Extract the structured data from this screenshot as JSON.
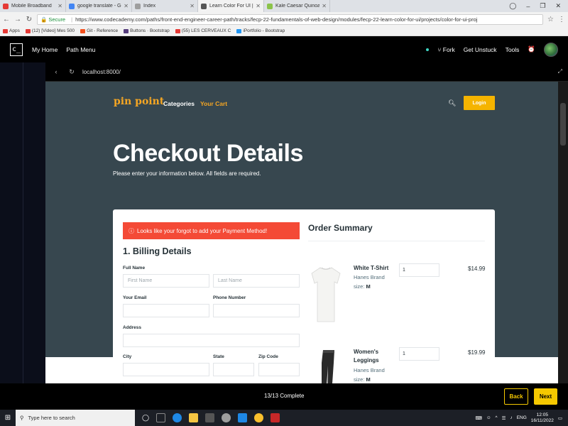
{
  "browser": {
    "tabs": [
      {
        "label": "Mobile Broadband",
        "color": "#e53935",
        "active": false
      },
      {
        "label": "google translate - Goog",
        "color": "#4285f4",
        "active": false
      },
      {
        "label": "Index",
        "color": "#9e9e9e",
        "active": false
      },
      {
        "label": "Learn Color For UI | Cod",
        "color": "#555555",
        "active": true
      },
      {
        "label": "Kale Caesar Quinoa Sala",
        "color": "#8bc34a",
        "active": false
      }
    ],
    "address": {
      "secure_label": "Secure",
      "url": "https://www.codecademy.com/paths/front-end-engineer-career-path/tracks/fecp-22-fundamentals-of-web-design/modules/fecp-22-learn-color-for-ui/projects/color-for-ui-proj"
    },
    "bookmarks": [
      {
        "label": "Apps",
        "color": "#e53935"
      },
      {
        "label": "(12) [Video] Mes 500",
        "color": "#e53935"
      },
      {
        "label": "Git - Reference",
        "color": "#f4511e"
      },
      {
        "label": "Buttons · Bootstrap",
        "color": "#563d7c"
      },
      {
        "label": "(55) LES CERVEAUX C",
        "color": "#e53935"
      },
      {
        "label": "iPortfolio - Bootstrap",
        "color": "#2196f3"
      }
    ]
  },
  "codecademy": {
    "logo": "c_",
    "nav": [
      "My Home",
      "Path Menu"
    ],
    "right": {
      "fork": "Fork",
      "unstuck": "Get Unstuck",
      "tools": "Tools"
    }
  },
  "inner_browser": {
    "url": "localhost:8000/"
  },
  "site": {
    "brand": "pin point",
    "nav": {
      "categories": "Categories",
      "cart": "Your Cart"
    },
    "login": "Login",
    "title": "Checkout Details",
    "subtitle": "Please enter your information below. All fields are required.",
    "alert": "Looks like your forgot to add your Payment Method!",
    "billing": {
      "title": "1. Billing Details",
      "full_name_label": "Full Name",
      "first_name_placeholder": "First Name",
      "last_name_placeholder": "Last Name",
      "email_label": "Your Email",
      "phone_label": "Phone Number",
      "address_label": "Address",
      "city_label": "City",
      "state_label": "State",
      "zip_label": "Zip Code"
    },
    "summary": {
      "title": "Order Summary",
      "items": [
        {
          "name": "White T-Shirt",
          "brand": "Hanes Brand",
          "size_label": "size:",
          "size": "M",
          "qty": "1",
          "price": "$14.99"
        },
        {
          "name": "Women's",
          "name2": "Leggings",
          "brand": "Hanes Brand",
          "size_label": "size:",
          "size": "M",
          "qty": "1",
          "price": "$19.99"
        }
      ]
    }
  },
  "footer": {
    "progress": "13/13 Complete",
    "back": "Back",
    "next": "Next"
  },
  "taskbar": {
    "search_placeholder": "Type here to search",
    "lang": "ENG",
    "time": "12:05",
    "date": "16/11/2022"
  },
  "colors": {
    "accent": "#f5a623",
    "alert": "#f44a36",
    "site_bg": "#37474f",
    "cta": "#f5c800"
  }
}
